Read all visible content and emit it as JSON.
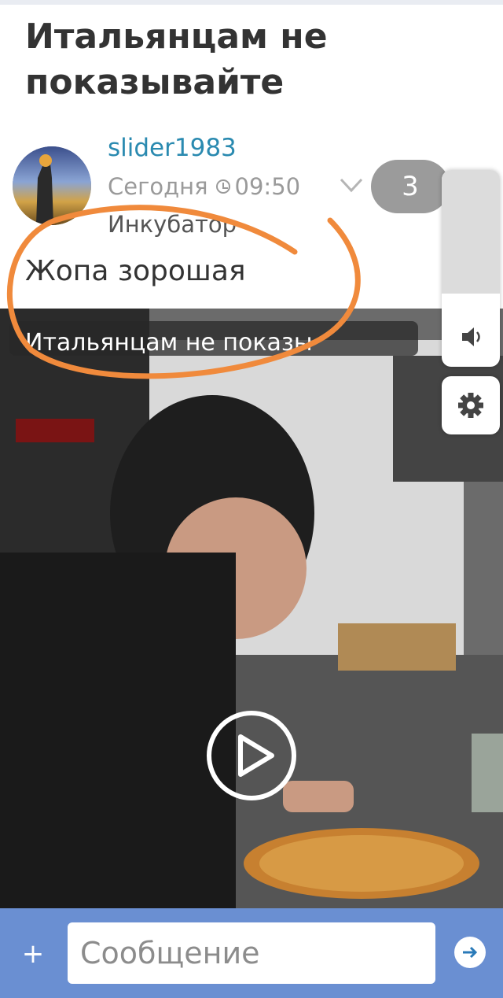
{
  "post": {
    "title": "Итальянцам не показывайте"
  },
  "comment": {
    "author": "slider1983",
    "date": "Сегодня",
    "time": "09:50",
    "replies_count": "3",
    "community": "Инкубатор",
    "text": "Жопа зорошая"
  },
  "video": {
    "title": "Итальянцам не показы",
    "volume_level": 0.13,
    "icons": {
      "play": "play-icon",
      "volume": "speaker-icon",
      "settings": "gear-icon"
    }
  },
  "composer": {
    "placeholder": "Сообщение",
    "add_icon": "plus-icon",
    "send_icon": "send-arrow-icon"
  },
  "colors": {
    "author_link": "#2a8ab0",
    "composer_bar": "#6a8fd2",
    "badge": "#9b9b9b",
    "annotation": "#f08a3c"
  }
}
